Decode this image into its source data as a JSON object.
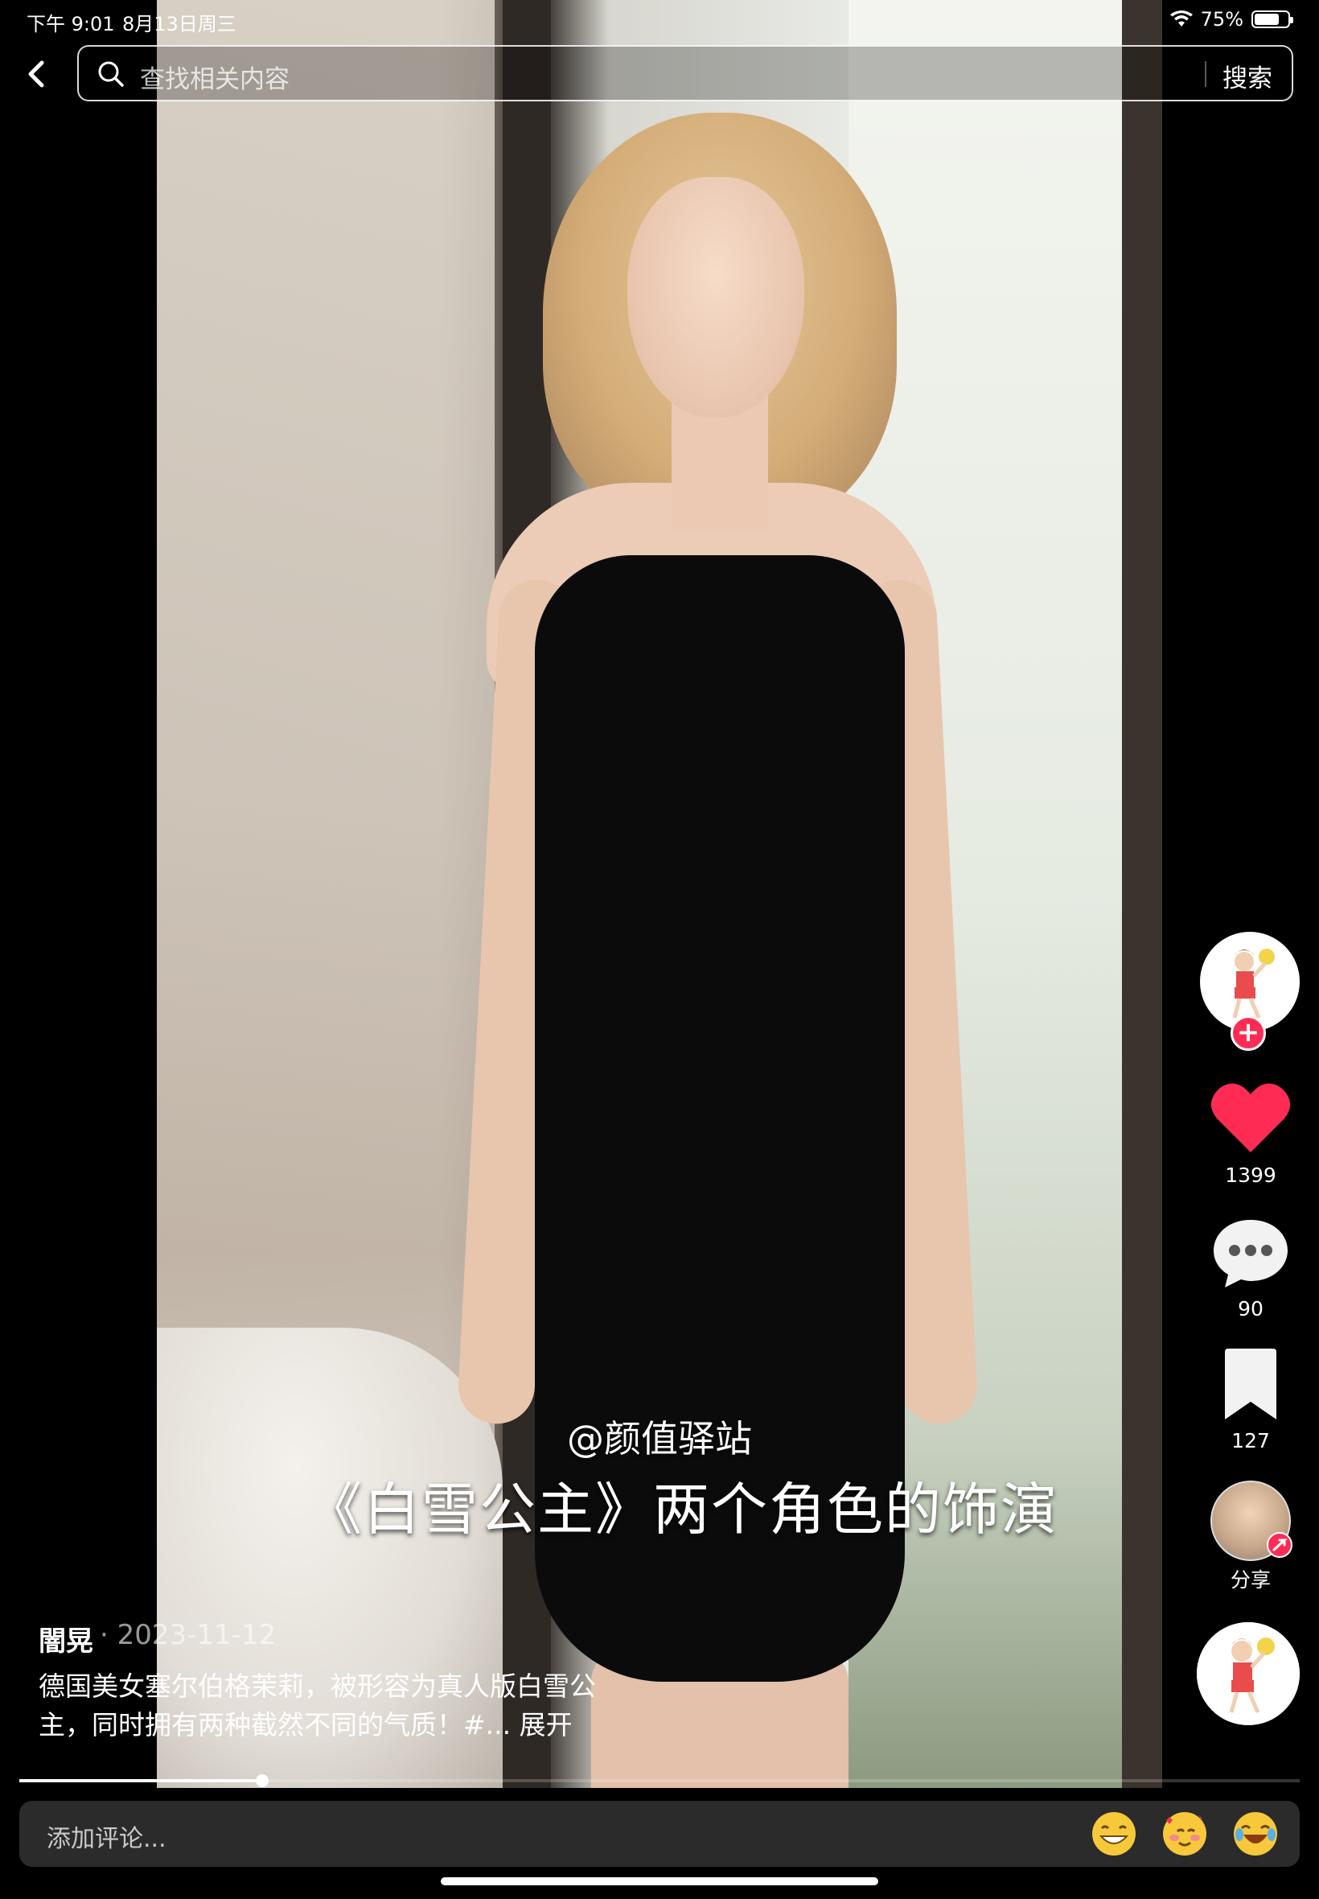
{
  "status_bar": {
    "time": "下午 9:01",
    "date": "8月13日周三",
    "battery": "75%",
    "battery_level": 0.75
  },
  "search": {
    "placeholder": "查找相关内容",
    "button_label": "搜索"
  },
  "video": {
    "overlay_tag": "@颜值驿站",
    "overlay_caption": "《白雪公主》两个角色的饰演",
    "progress": 0.19
  },
  "actions": {
    "like_count": "1399",
    "comment_count": "90",
    "favorite_count": "127",
    "share_label": "分享"
  },
  "post": {
    "author": "闇晃",
    "date": "· 2023-11-12",
    "description": "德国美女塞尔伯格茉莉，被形容为真人版白雪公主，同时拥有两种截然不同的气质！#...",
    "expand_label": "展开"
  },
  "comment": {
    "placeholder": "添加评论..."
  },
  "colors": {
    "accent": "#fe2c55",
    "background": "#000000"
  },
  "icons": [
    "back-arrow-icon",
    "search-icon",
    "plus-icon",
    "heart-icon",
    "comment-icon",
    "bookmark-icon",
    "share-icon",
    "grin-emoji-icon",
    "heart-eyes-emoji-icon",
    "laugh-emoji-icon",
    "wifi-icon",
    "battery-icon"
  ]
}
